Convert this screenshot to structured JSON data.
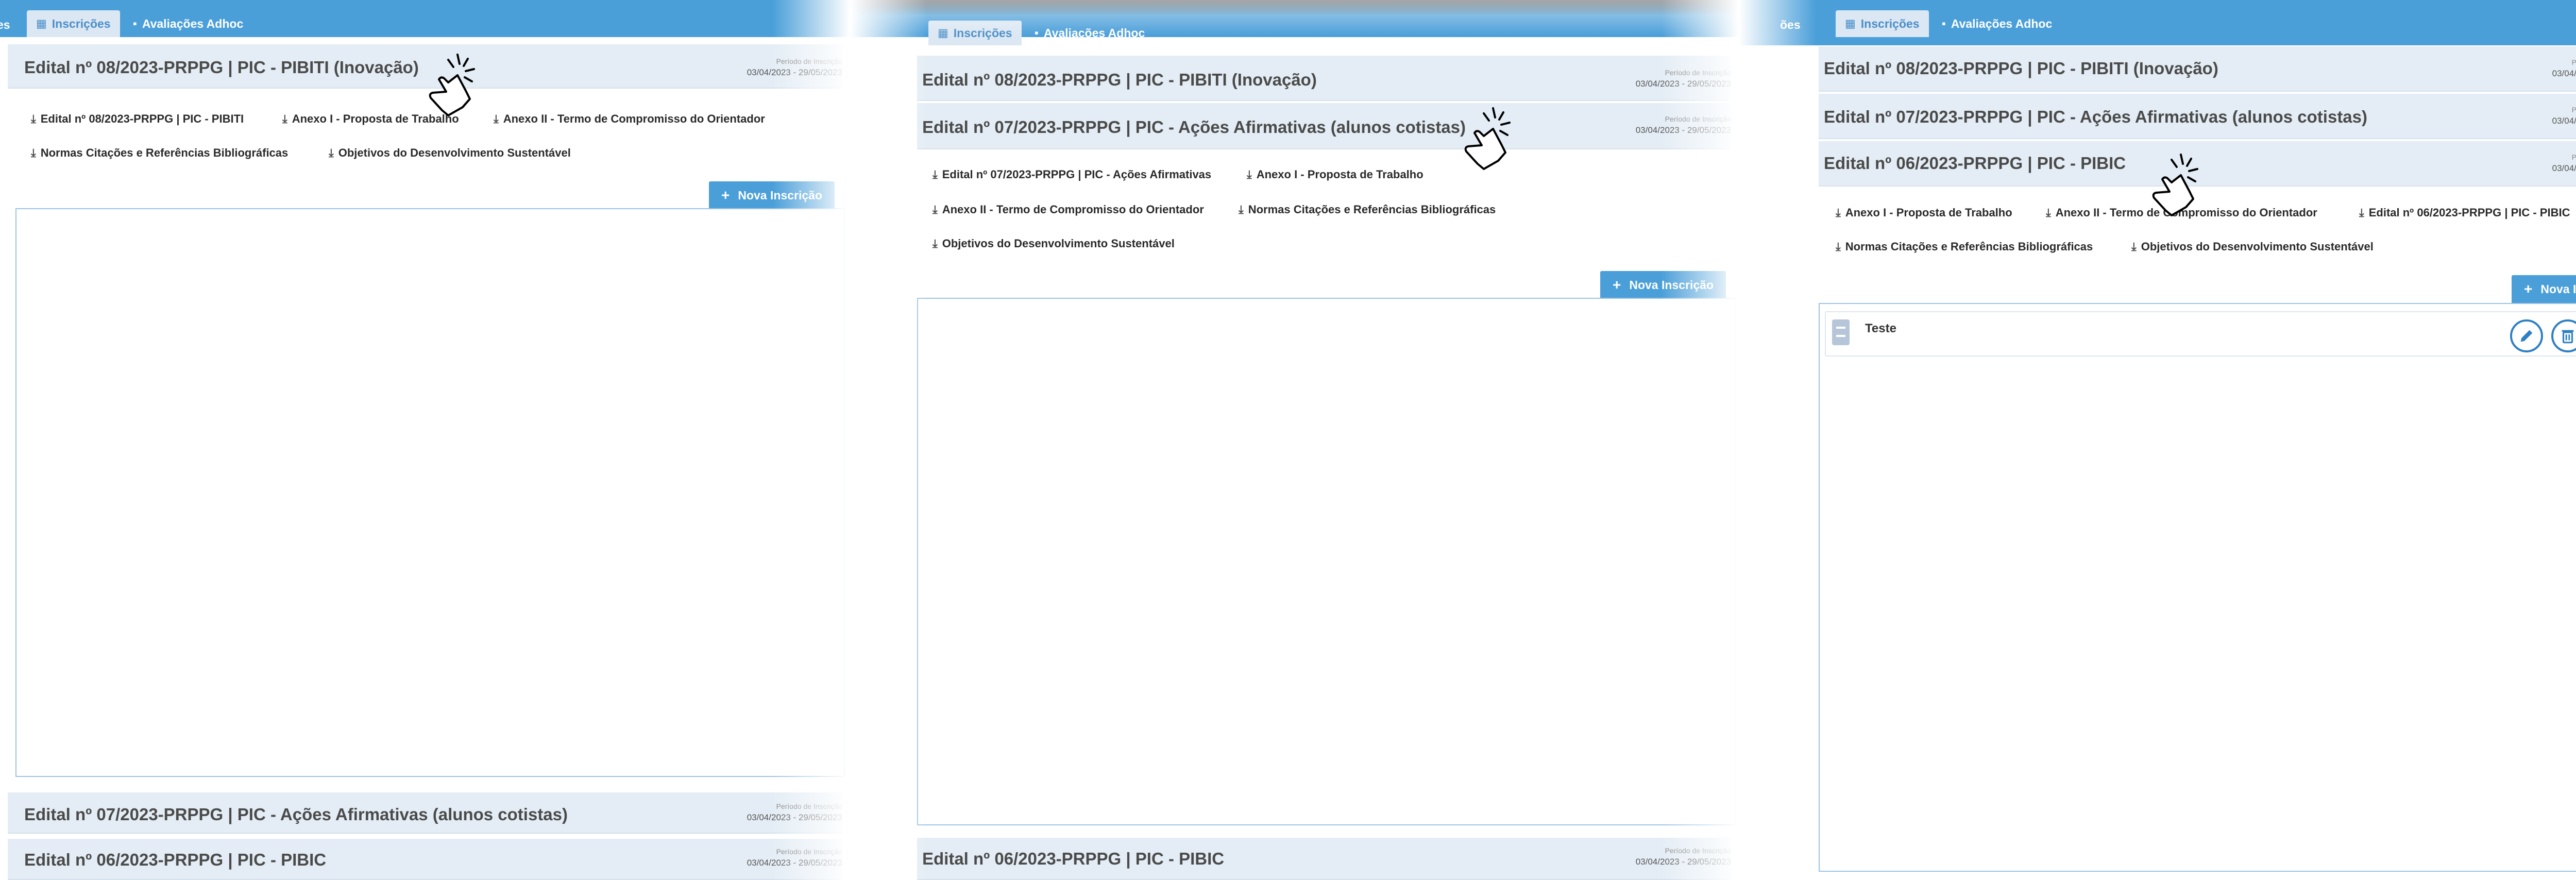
{
  "nav": {
    "tabs": [
      {
        "label": "Inscrições"
      },
      {
        "label": "Avaliações Adhoc"
      }
    ],
    "cut_label_left": "es",
    "cut_label_mid": "ões"
  },
  "editais": {
    "e08": {
      "title": "Edital nº 08/2023-PRPPG | PIC - PIBITI (Inovação)"
    },
    "e07": {
      "title": "Edital nº 07/2023-PRPPG | PIC - Ações Afirmativas (alunos cotistas)"
    },
    "e06": {
      "title": "Edital nº 06/2023-PRPPG | PIC - PIBIC"
    },
    "periodo_label": "Período de Inscrição",
    "periodo_value": "03/04/2023 - 29/05/2023",
    "periodo_value_cut": "03/04/2023 - 29/05/20"
  },
  "downloads": {
    "p1": [
      "Edital nº 08/2023-PRPPG | PIC - PIBITI",
      "Anexo I - Proposta de Trabalho",
      "Anexo II - Termo de Compromisso do Orientador",
      "Normas Citações e Referências Bibliográficas",
      "Objetivos do Desenvolvimento Sustentável"
    ],
    "p2": [
      "Edital nº 07/2023-PRPPG | PIC - Ações Afirmativas",
      "Anexo I - Proposta de Trabalho",
      "Anexo II - Termo de Compromisso do Orientador",
      "Normas Citações e Referências Bibliográficas",
      "Objetivos do Desenvolvimento Sustentável"
    ],
    "p3": [
      "Anexo I - Proposta de Trabalho",
      "Anexo II - Termo de Compromisso do Orientador",
      "Edital nº 06/2023-PRPPG | PIC - PIBIC",
      "Normas Citações e Referências Bibliográficas",
      "Objetivos do Desenvolvimento Sustentável"
    ]
  },
  "actions": {
    "nova_inscricao": "Nova Inscrição"
  },
  "inscricoes": [
    {
      "name": "Teste"
    }
  ],
  "icons": {
    "calendar": "calendar-icon",
    "document": "document-icon",
    "download": "download-icon",
    "plus": "plus-icon",
    "edit": "pencil-icon",
    "delete": "trash-icon",
    "file": "file-icon",
    "cursor": "pointer-cursor-icon"
  },
  "colors": {
    "primary": "#4b9fd9",
    "accordion_bg": "#e4edf5",
    "action_ring": "#2e7fc4"
  }
}
